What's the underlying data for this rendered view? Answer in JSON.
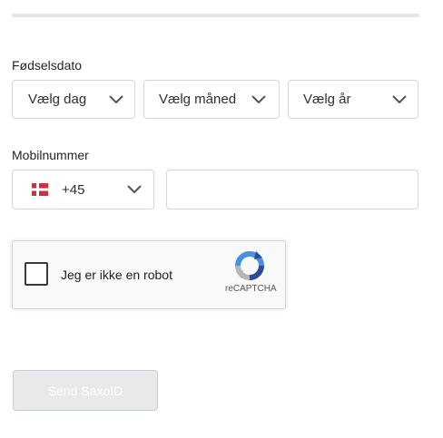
{
  "birthdate": {
    "label": "Fødselsdato",
    "day_select": "Vælg dag",
    "month_select": "Vælg måned",
    "year_select": "Vælg år"
  },
  "mobile": {
    "label": "Mobilnummer",
    "country_code": "+45",
    "country_flag": "denmark-flag-icon",
    "number_value": ""
  },
  "captcha": {
    "label": "Jeg er ikke en robot",
    "brand": "reCAPTCHA",
    "checked": false
  },
  "submit": {
    "label": "Send SaxoID",
    "disabled": true
  },
  "colors": {
    "divider": "#e6e6e6",
    "border": "#d3d6db",
    "button_bg": "#e8e9eb",
    "button_text": "#ffffff",
    "flag_red": "#d0303c"
  }
}
